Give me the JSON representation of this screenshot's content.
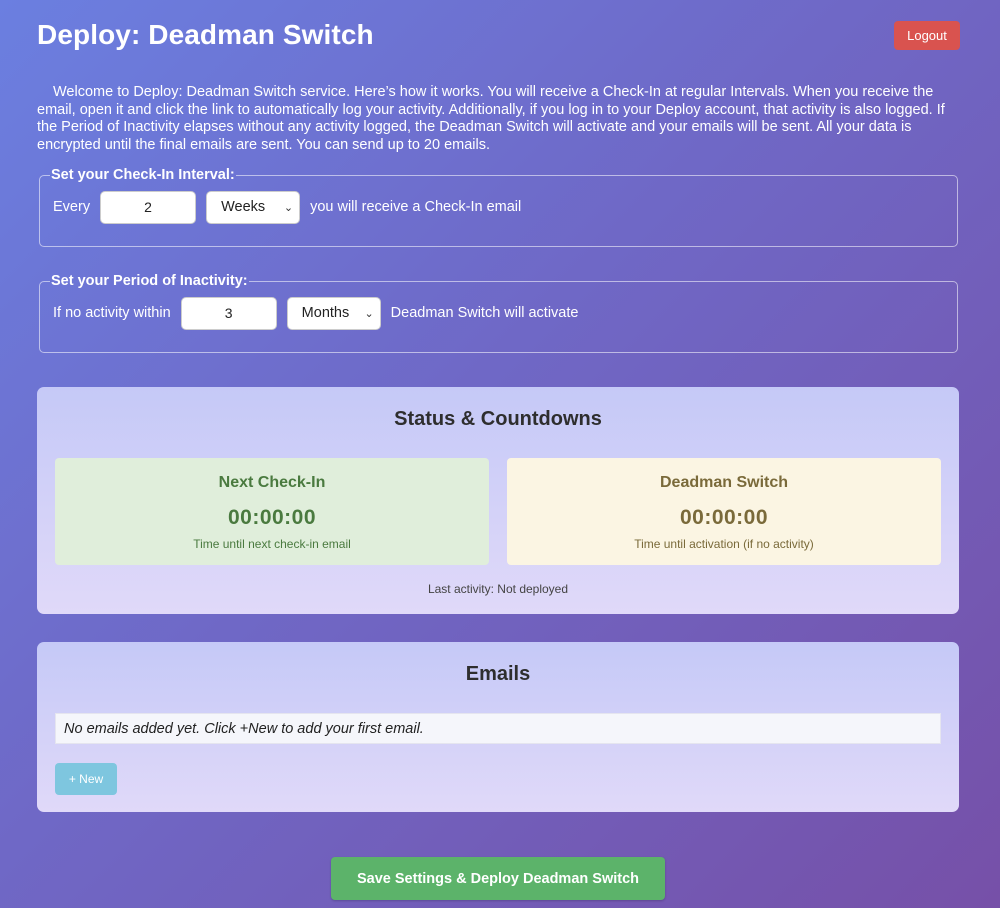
{
  "header": {
    "title": "Deploy: Deadman Switch",
    "logout_label": "Logout"
  },
  "intro": "Welcome to Deploy: Deadman Switch service. Here’s how it works. You will receive a Check-In at regular Intervals. When you receive the email, open it and click the link to automatically log your activity. Additionally, if you log in to your Deploy account, that activity is also logged. If the Period of Inactivity elapses without any activity logged, the Deadman Switch will activate and your emails will be sent. All your data is encrypted until the final emails are sent. You can send up to 20 emails.",
  "checkin": {
    "legend": "Set your Check-In Interval:",
    "prefix": "Every",
    "value": "2",
    "unit": "Weeks",
    "suffix": "you will receive a Check-In email"
  },
  "inactivity": {
    "legend": "Set your Period of Inactivity:",
    "prefix": "If no activity within",
    "value": "3",
    "unit": "Months",
    "suffix": "Deadman Switch will activate"
  },
  "status": {
    "title": "Status & Countdowns",
    "next_checkin": {
      "title": "Next Check-In",
      "time": "00:00:00",
      "subtitle": "Time until next check-in email"
    },
    "deadman": {
      "title": "Deadman Switch",
      "time": "00:00:00",
      "subtitle": "Time until activation (if no activity)"
    },
    "last_activity": "Last activity: Not deployed"
  },
  "emails": {
    "title": "Emails",
    "empty_message": "No emails added yet. Click +New to add your first email.",
    "new_label": "+ New"
  },
  "deploy_label": "Save Settings & Deploy Deadman Switch",
  "colors": {
    "logout": "#d9534f",
    "new_button": "#7ec6df",
    "deploy_button": "#5cb36a",
    "checkin_card": "#e0eedb",
    "deadman_card": "#fbf5e3"
  },
  "icons": {
    "select_arrow": "chevron-down-icon"
  }
}
